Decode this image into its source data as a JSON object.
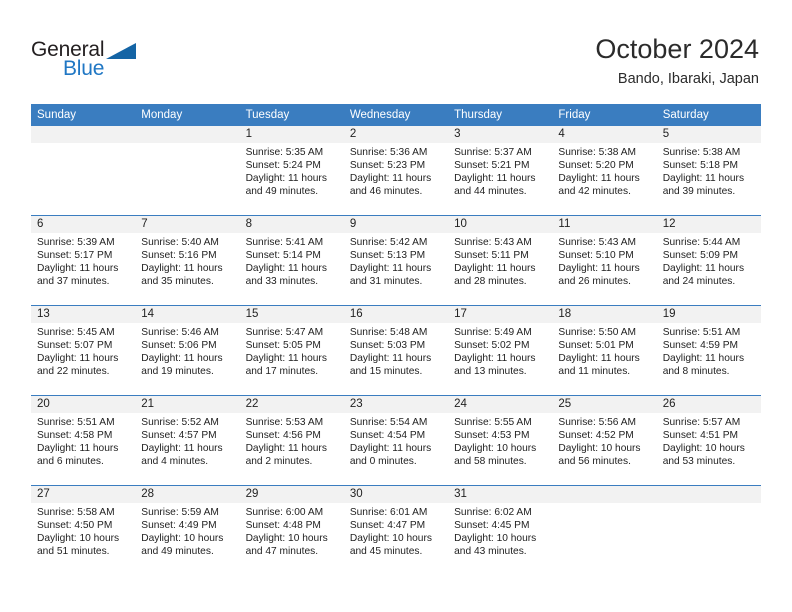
{
  "brand": {
    "name_part1": "General",
    "name_part2": "Blue",
    "accent_color": "#1464a5",
    "logo_icon": "triangle-icon"
  },
  "header": {
    "title": "October 2024",
    "subtitle": "Bando, Ibaraki, Japan"
  },
  "theme": {
    "header_row_color": "#3a7dc0",
    "daynum_band_color": "#f2f2f2",
    "text_color": "#222222"
  },
  "weekday_headers": [
    "Sunday",
    "Monday",
    "Tuesday",
    "Wednesday",
    "Thursday",
    "Friday",
    "Saturday"
  ],
  "weeks": [
    [
      {
        "day": "",
        "sunrise": "",
        "sunset": "",
        "daylight1": "",
        "daylight2": "",
        "empty": true
      },
      {
        "day": "",
        "sunrise": "",
        "sunset": "",
        "daylight1": "",
        "daylight2": "",
        "empty": true
      },
      {
        "day": "1",
        "sunrise": "Sunrise: 5:35 AM",
        "sunset": "Sunset: 5:24 PM",
        "daylight1": "Daylight: 11 hours",
        "daylight2": "and 49 minutes."
      },
      {
        "day": "2",
        "sunrise": "Sunrise: 5:36 AM",
        "sunset": "Sunset: 5:23 PM",
        "daylight1": "Daylight: 11 hours",
        "daylight2": "and 46 minutes."
      },
      {
        "day": "3",
        "sunrise": "Sunrise: 5:37 AM",
        "sunset": "Sunset: 5:21 PM",
        "daylight1": "Daylight: 11 hours",
        "daylight2": "and 44 minutes."
      },
      {
        "day": "4",
        "sunrise": "Sunrise: 5:38 AM",
        "sunset": "Sunset: 5:20 PM",
        "daylight1": "Daylight: 11 hours",
        "daylight2": "and 42 minutes."
      },
      {
        "day": "5",
        "sunrise": "Sunrise: 5:38 AM",
        "sunset": "Sunset: 5:18 PM",
        "daylight1": "Daylight: 11 hours",
        "daylight2": "and 39 minutes."
      }
    ],
    [
      {
        "day": "6",
        "sunrise": "Sunrise: 5:39 AM",
        "sunset": "Sunset: 5:17 PM",
        "daylight1": "Daylight: 11 hours",
        "daylight2": "and 37 minutes."
      },
      {
        "day": "7",
        "sunrise": "Sunrise: 5:40 AM",
        "sunset": "Sunset: 5:16 PM",
        "daylight1": "Daylight: 11 hours",
        "daylight2": "and 35 minutes."
      },
      {
        "day": "8",
        "sunrise": "Sunrise: 5:41 AM",
        "sunset": "Sunset: 5:14 PM",
        "daylight1": "Daylight: 11 hours",
        "daylight2": "and 33 minutes."
      },
      {
        "day": "9",
        "sunrise": "Sunrise: 5:42 AM",
        "sunset": "Sunset: 5:13 PM",
        "daylight1": "Daylight: 11 hours",
        "daylight2": "and 31 minutes."
      },
      {
        "day": "10",
        "sunrise": "Sunrise: 5:43 AM",
        "sunset": "Sunset: 5:11 PM",
        "daylight1": "Daylight: 11 hours",
        "daylight2": "and 28 minutes."
      },
      {
        "day": "11",
        "sunrise": "Sunrise: 5:43 AM",
        "sunset": "Sunset: 5:10 PM",
        "daylight1": "Daylight: 11 hours",
        "daylight2": "and 26 minutes."
      },
      {
        "day": "12",
        "sunrise": "Sunrise: 5:44 AM",
        "sunset": "Sunset: 5:09 PM",
        "daylight1": "Daylight: 11 hours",
        "daylight2": "and 24 minutes."
      }
    ],
    [
      {
        "day": "13",
        "sunrise": "Sunrise: 5:45 AM",
        "sunset": "Sunset: 5:07 PM",
        "daylight1": "Daylight: 11 hours",
        "daylight2": "and 22 minutes."
      },
      {
        "day": "14",
        "sunrise": "Sunrise: 5:46 AM",
        "sunset": "Sunset: 5:06 PM",
        "daylight1": "Daylight: 11 hours",
        "daylight2": "and 19 minutes."
      },
      {
        "day": "15",
        "sunrise": "Sunrise: 5:47 AM",
        "sunset": "Sunset: 5:05 PM",
        "daylight1": "Daylight: 11 hours",
        "daylight2": "and 17 minutes."
      },
      {
        "day": "16",
        "sunrise": "Sunrise: 5:48 AM",
        "sunset": "Sunset: 5:03 PM",
        "daylight1": "Daylight: 11 hours",
        "daylight2": "and 15 minutes."
      },
      {
        "day": "17",
        "sunrise": "Sunrise: 5:49 AM",
        "sunset": "Sunset: 5:02 PM",
        "daylight1": "Daylight: 11 hours",
        "daylight2": "and 13 minutes."
      },
      {
        "day": "18",
        "sunrise": "Sunrise: 5:50 AM",
        "sunset": "Sunset: 5:01 PM",
        "daylight1": "Daylight: 11 hours",
        "daylight2": "and 11 minutes."
      },
      {
        "day": "19",
        "sunrise": "Sunrise: 5:51 AM",
        "sunset": "Sunset: 4:59 PM",
        "daylight1": "Daylight: 11 hours",
        "daylight2": "and 8 minutes."
      }
    ],
    [
      {
        "day": "20",
        "sunrise": "Sunrise: 5:51 AM",
        "sunset": "Sunset: 4:58 PM",
        "daylight1": "Daylight: 11 hours",
        "daylight2": "and 6 minutes."
      },
      {
        "day": "21",
        "sunrise": "Sunrise: 5:52 AM",
        "sunset": "Sunset: 4:57 PM",
        "daylight1": "Daylight: 11 hours",
        "daylight2": "and 4 minutes."
      },
      {
        "day": "22",
        "sunrise": "Sunrise: 5:53 AM",
        "sunset": "Sunset: 4:56 PM",
        "daylight1": "Daylight: 11 hours",
        "daylight2": "and 2 minutes."
      },
      {
        "day": "23",
        "sunrise": "Sunrise: 5:54 AM",
        "sunset": "Sunset: 4:54 PM",
        "daylight1": "Daylight: 11 hours",
        "daylight2": "and 0 minutes."
      },
      {
        "day": "24",
        "sunrise": "Sunrise: 5:55 AM",
        "sunset": "Sunset: 4:53 PM",
        "daylight1": "Daylight: 10 hours",
        "daylight2": "and 58 minutes."
      },
      {
        "day": "25",
        "sunrise": "Sunrise: 5:56 AM",
        "sunset": "Sunset: 4:52 PM",
        "daylight1": "Daylight: 10 hours",
        "daylight2": "and 56 minutes."
      },
      {
        "day": "26",
        "sunrise": "Sunrise: 5:57 AM",
        "sunset": "Sunset: 4:51 PM",
        "daylight1": "Daylight: 10 hours",
        "daylight2": "and 53 minutes."
      }
    ],
    [
      {
        "day": "27",
        "sunrise": "Sunrise: 5:58 AM",
        "sunset": "Sunset: 4:50 PM",
        "daylight1": "Daylight: 10 hours",
        "daylight2": "and 51 minutes."
      },
      {
        "day": "28",
        "sunrise": "Sunrise: 5:59 AM",
        "sunset": "Sunset: 4:49 PM",
        "daylight1": "Daylight: 10 hours",
        "daylight2": "and 49 minutes."
      },
      {
        "day": "29",
        "sunrise": "Sunrise: 6:00 AM",
        "sunset": "Sunset: 4:48 PM",
        "daylight1": "Daylight: 10 hours",
        "daylight2": "and 47 minutes."
      },
      {
        "day": "30",
        "sunrise": "Sunrise: 6:01 AM",
        "sunset": "Sunset: 4:47 PM",
        "daylight1": "Daylight: 10 hours",
        "daylight2": "and 45 minutes."
      },
      {
        "day": "31",
        "sunrise": "Sunrise: 6:02 AM",
        "sunset": "Sunset: 4:45 PM",
        "daylight1": "Daylight: 10 hours",
        "daylight2": "and 43 minutes."
      },
      {
        "day": "",
        "sunrise": "",
        "sunset": "",
        "daylight1": "",
        "daylight2": "",
        "empty": true
      },
      {
        "day": "",
        "sunrise": "",
        "sunset": "",
        "daylight1": "",
        "daylight2": "",
        "empty": true
      }
    ]
  ]
}
